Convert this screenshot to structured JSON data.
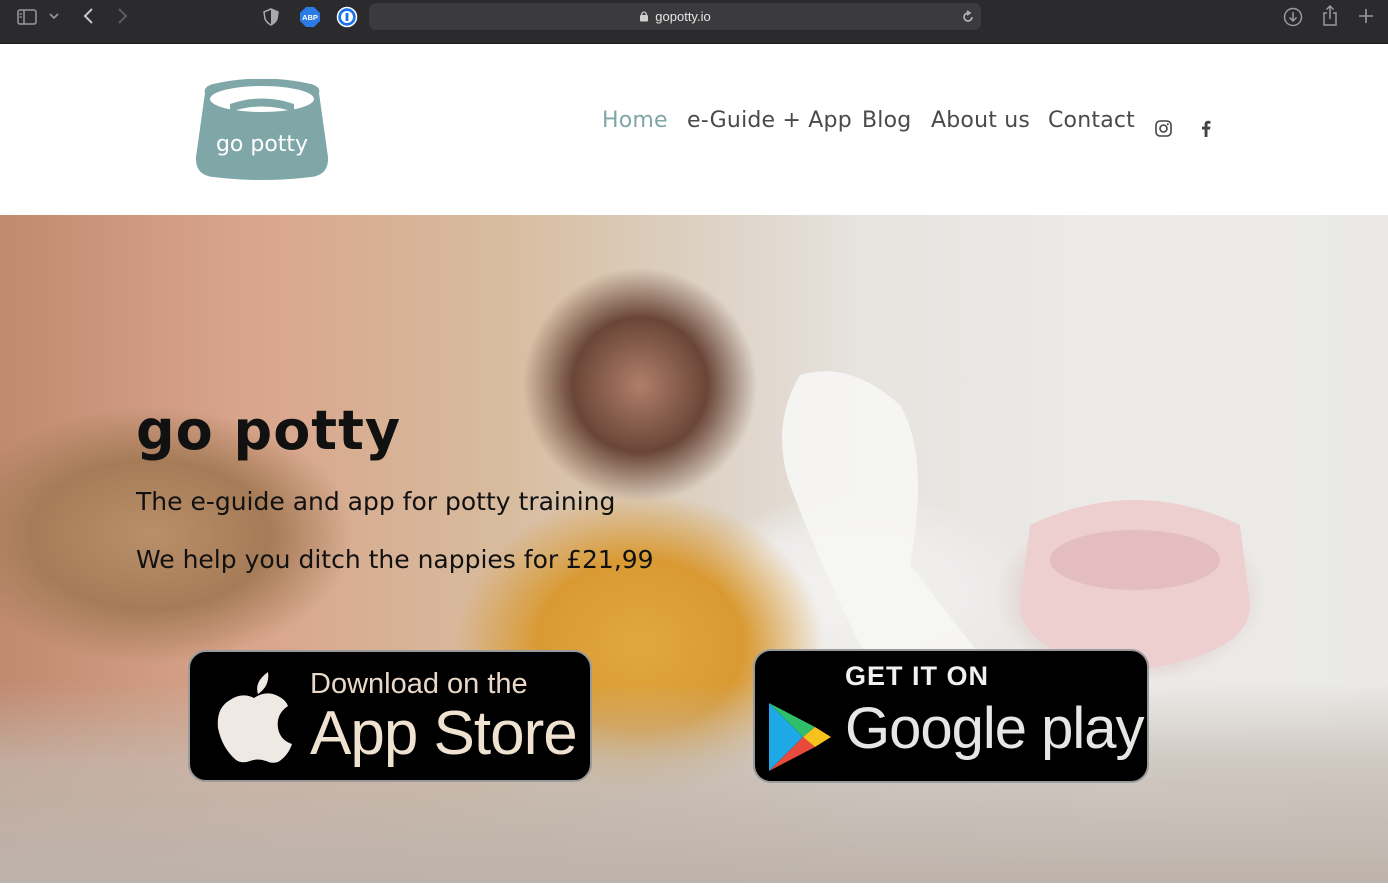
{
  "browser": {
    "url": "gopotty.io",
    "icons": [
      "sidebar-icon",
      "chevron-down-icon",
      "back-icon",
      "forward-icon",
      "privacy-shield-icon",
      "adblock-icon",
      "password-manager-icon",
      "lock-icon",
      "reload-icon",
      "download-icon",
      "share-icon",
      "new-tab-icon"
    ],
    "adblock_label": "ABP"
  },
  "header": {
    "logo_text": "go potty",
    "nav": [
      {
        "label": "Home",
        "active": true
      },
      {
        "label": "e-Guide + App",
        "active": false
      },
      {
        "label": "Blog",
        "active": false
      },
      {
        "label": "About us",
        "active": false
      },
      {
        "label": "Contact",
        "active": false
      }
    ],
    "social": [
      "instagram-icon",
      "facebook-icon"
    ]
  },
  "hero": {
    "title": "go potty",
    "subtitle": "The e-guide and app for potty training",
    "tagline": "We help you ditch the nappies for £21,99",
    "appstore": {
      "small": "Download on the",
      "big": "App Store"
    },
    "playstore": {
      "small": "GET IT ON",
      "big": "Google play"
    }
  },
  "colors": {
    "accent": "#7fa7a7",
    "logo": "#7fa7a7",
    "toolbar": "#2b2a2c",
    "nav_text": "#4a4a4a"
  }
}
